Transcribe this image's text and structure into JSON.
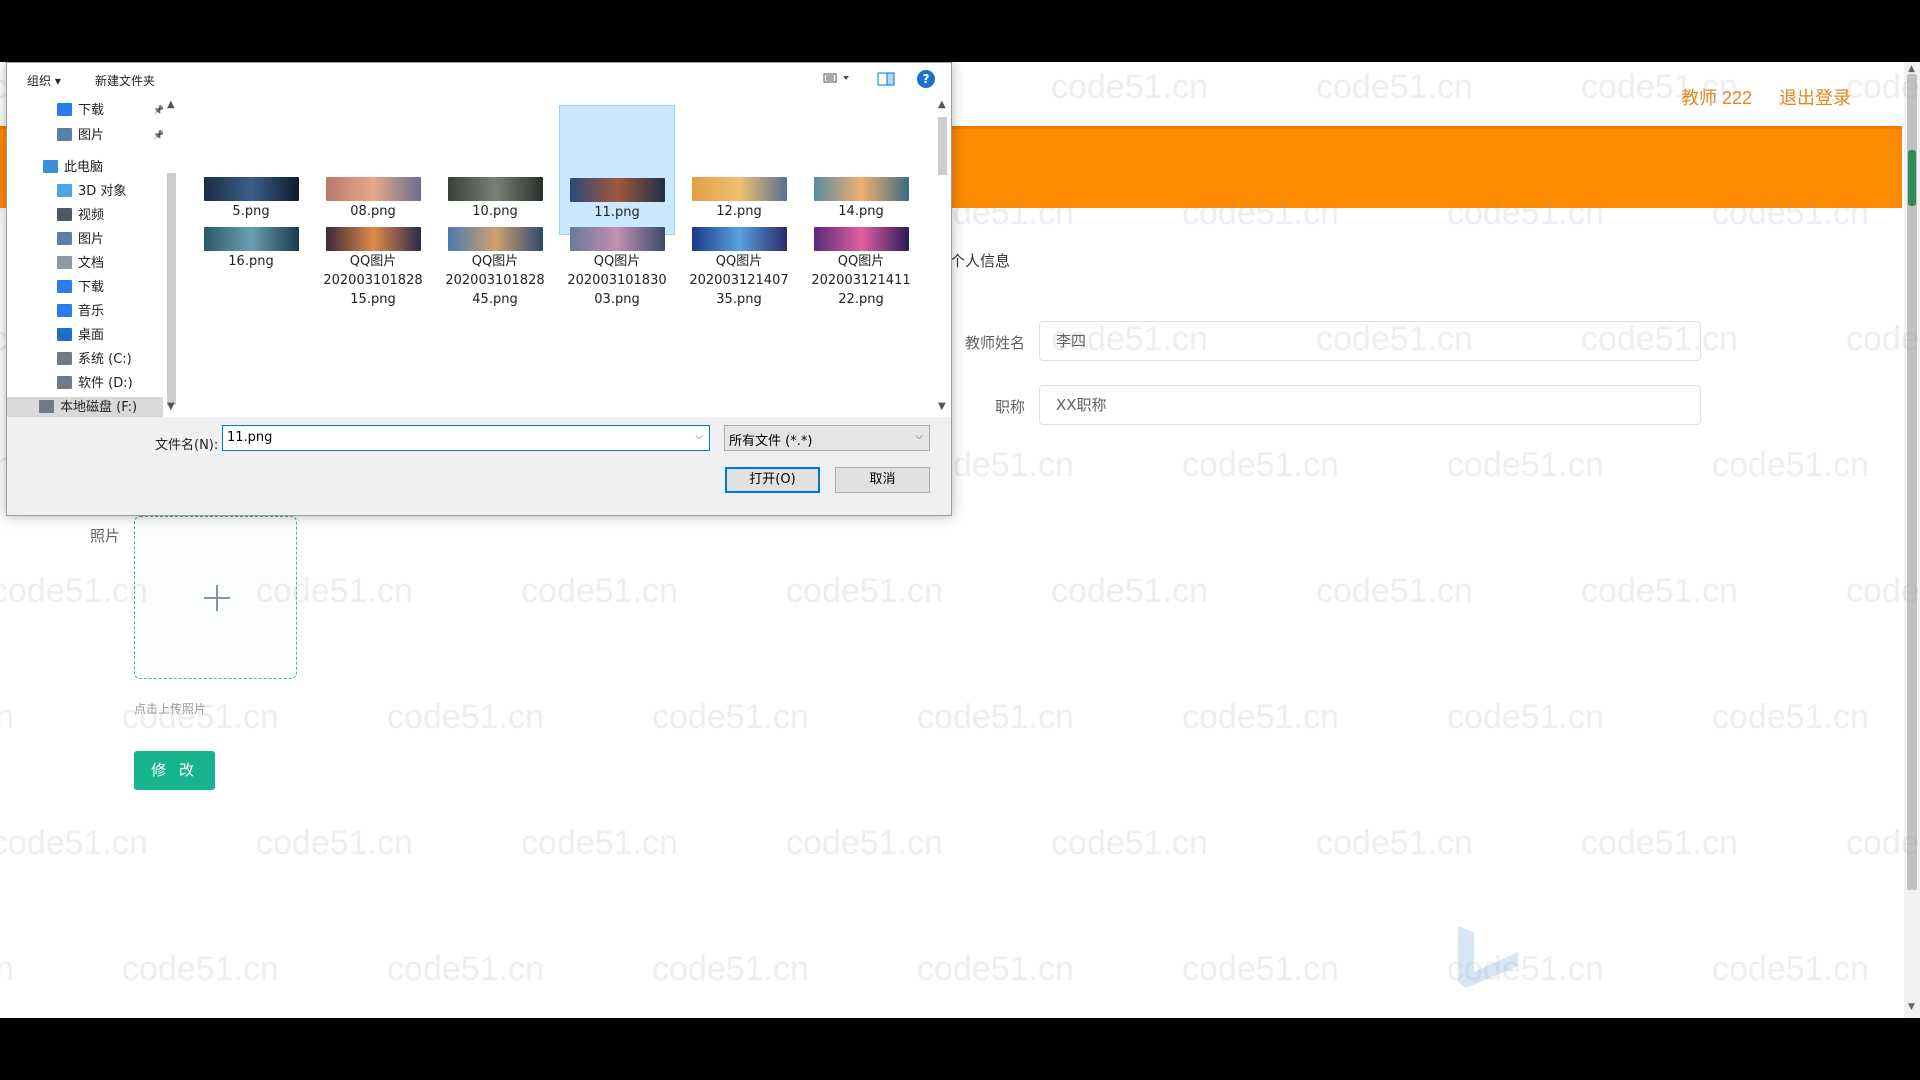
{
  "page": {
    "user_name": "教师 222",
    "logout": "退出登录",
    "section_title": "个人信息",
    "fields": {
      "name_label": "教师姓名",
      "name_value": "李四",
      "title_label": "职称",
      "title_value": "XX职称"
    },
    "photo_label": "照片",
    "upload_tip": "点击上传照片",
    "edit_button": "修 改",
    "watermark": "code51.cn",
    "colors": {
      "banner": "#ff8a00",
      "accent": "#17b38e",
      "user_text": "#e8861a"
    }
  },
  "dialog": {
    "toolbar": {
      "organize": "组织 ▾",
      "new_folder": "新建文件夹",
      "help": "?"
    },
    "nav": [
      {
        "label": "下载",
        "icon": "download-arrow-icon",
        "pinned": true
      },
      {
        "label": "图片",
        "icon": "pictures-icon",
        "pinned": true
      },
      {
        "label": "此电脑",
        "icon": "computer-icon"
      },
      {
        "label": "3D 对象",
        "icon": "3d-objects-icon"
      },
      {
        "label": "视频",
        "icon": "videos-icon"
      },
      {
        "label": "图片",
        "icon": "pictures-icon"
      },
      {
        "label": "文档",
        "icon": "documents-icon"
      },
      {
        "label": "下载",
        "icon": "download-arrow-icon"
      },
      {
        "label": "音乐",
        "icon": "music-icon"
      },
      {
        "label": "桌面",
        "icon": "desktop-icon"
      },
      {
        "label": "系统 (C:)",
        "icon": "drive-icon"
      },
      {
        "label": "软件 (D:)",
        "icon": "drive-icon"
      },
      {
        "label": "本地磁盘 (F:)",
        "icon": "drive-icon",
        "selected": true
      }
    ],
    "files": [
      {
        "name": "5.png",
        "line2": "",
        "line3": ""
      },
      {
        "name": "08.png",
        "line2": "",
        "line3": ""
      },
      {
        "name": "10.png",
        "line2": "",
        "line3": ""
      },
      {
        "name": "11.png",
        "line2": "",
        "line3": "",
        "selected": true
      },
      {
        "name": "12.png",
        "line2": "",
        "line3": ""
      },
      {
        "name": "14.png",
        "line2": "",
        "line3": ""
      },
      {
        "name": "16.png",
        "line2": "",
        "line3": ""
      },
      {
        "name": "QQ图片",
        "line2": "202003101828",
        "line3": "15.png"
      },
      {
        "name": "QQ图片",
        "line2": "202003101828",
        "line3": "45.png"
      },
      {
        "name": "QQ图片",
        "line2": "202003101830",
        "line3": "03.png"
      },
      {
        "name": "QQ图片",
        "line2": "202003121407",
        "line3": "35.png"
      },
      {
        "name": "QQ图片",
        "line2": "202003121411",
        "line3": "22.png"
      }
    ],
    "filename_label": "文件名(N):",
    "filename_value": "11.png",
    "filetype": "所有文件 (*.*)",
    "open_button": "打开(O)",
    "cancel_button": "取消"
  }
}
